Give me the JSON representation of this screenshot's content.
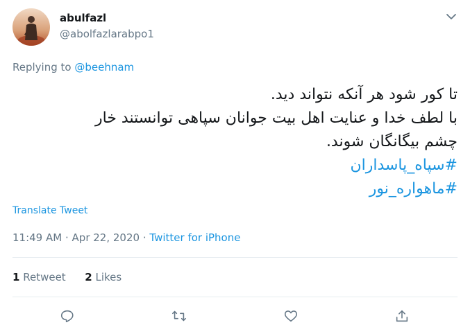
{
  "author": {
    "name": "abulfazl",
    "handle": "@abolfazlarabpo1"
  },
  "reply": {
    "prefix": "Replying to",
    "to": "@beehnam"
  },
  "tweet": {
    "line1": "تا کور شود هر آنکه نتواند دید.",
    "line2": "با لطف خدا و عنایت اهل بیت جوانان سپاهی توانستند خار",
    "line3": "چشم بیگانگان شوند.",
    "hashtag1": "#سپاه_پاسداران",
    "hashtag2": "#ماهواره_نور"
  },
  "translate_label": "Translate Tweet",
  "meta": {
    "time": "11:49 AM",
    "sep1": "·",
    "date": "Apr 22, 2020",
    "sep2": "·",
    "source": "Twitter for iPhone"
  },
  "stats": {
    "retweets_count": "1",
    "retweets_label": "Retweet",
    "likes_count": "2",
    "likes_label": "Likes"
  },
  "icons": {
    "reply": "reply-icon",
    "retweet": "retweet-icon",
    "like": "heart-icon",
    "share": "share-icon",
    "caret": "chevron-down-icon"
  },
  "colors": {
    "link": "#1b95e0",
    "muted": "#657786",
    "text": "#14171a"
  }
}
